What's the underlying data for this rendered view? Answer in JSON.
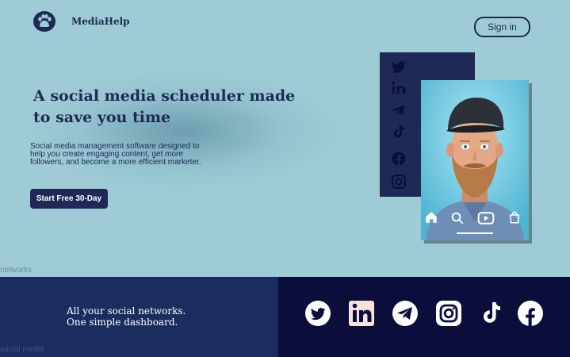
{
  "header": {
    "brand": "MediaHelp",
    "logo_icon": "paw-icon",
    "sign_in_label": "Sign in"
  },
  "hero": {
    "title": "A social media scheduler made to save you time",
    "description": "Social media management software designed to help you create engaging content, get more followers, and become a more efficient marketer.",
    "cta_label": "Start Free 30-Day",
    "side_icons": [
      "twitter-icon",
      "linkedin-icon",
      "telegram-icon",
      "tiktok-icon",
      "facebook-icon",
      "instagram-icon"
    ],
    "phone_nav_icons": [
      "home-icon",
      "search-icon",
      "play-icon",
      "shopping-bag-icon"
    ]
  },
  "ghost_labels": {
    "networks": "networks",
    "social_media": "social media"
  },
  "footer": {
    "tagline_line1": "All your social networks.",
    "tagline_line2": "One simple dashboard.",
    "social_icons": [
      "twitter-icon",
      "linkedin-icon",
      "telegram-icon",
      "instagram-icon",
      "tiktok-icon",
      "facebook-icon"
    ]
  },
  "colors": {
    "background": "#9ecbd6",
    "brand_navy": "#1e2a55",
    "footer_left": "#1a2d5e",
    "footer_right": "#0b0e3a"
  }
}
